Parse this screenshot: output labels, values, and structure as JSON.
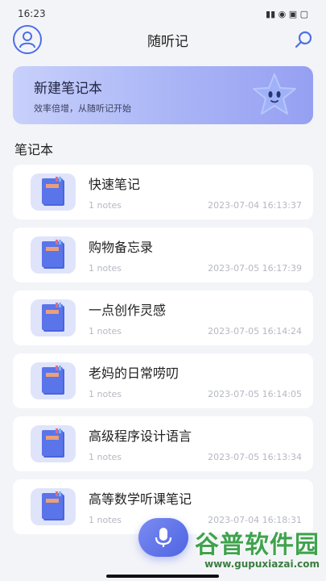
{
  "status_bar": {
    "time": "16:23",
    "icons": "▮▮ ◉ ▣ ▢"
  },
  "header": {
    "title": "随听记"
  },
  "banner": {
    "title": "新建笔记本",
    "subtitle": "效率倍增，从随听记开始"
  },
  "section": {
    "title": "笔记本"
  },
  "notebooks": [
    {
      "title": "快速笔记",
      "count": "1 notes",
      "date": "2023-07-04 16:13:37"
    },
    {
      "title": "购物备忘录",
      "count": "1 notes",
      "date": "2023-07-05 16:17:39"
    },
    {
      "title": "一点创作灵感",
      "count": "1 notes",
      "date": "2023-07-05 16:14:24"
    },
    {
      "title": "老妈的日常唠叨",
      "count": "1 notes",
      "date": "2023-07-05 16:14:05"
    },
    {
      "title": "高级程序设计语言",
      "count": "1 notes",
      "date": "2023-07-05 16:13:34"
    },
    {
      "title": "高等数学听课笔记",
      "count": "1 notes",
      "date": "2023-07-04 16:18:31"
    }
  ],
  "watermark": {
    "main": "谷普软件园",
    "url": "www.gupuxiazai.com"
  },
  "colors": {
    "accent": "#4d6fe6",
    "banner_start": "#c8d0fb",
    "banner_end": "#96a0f2"
  }
}
